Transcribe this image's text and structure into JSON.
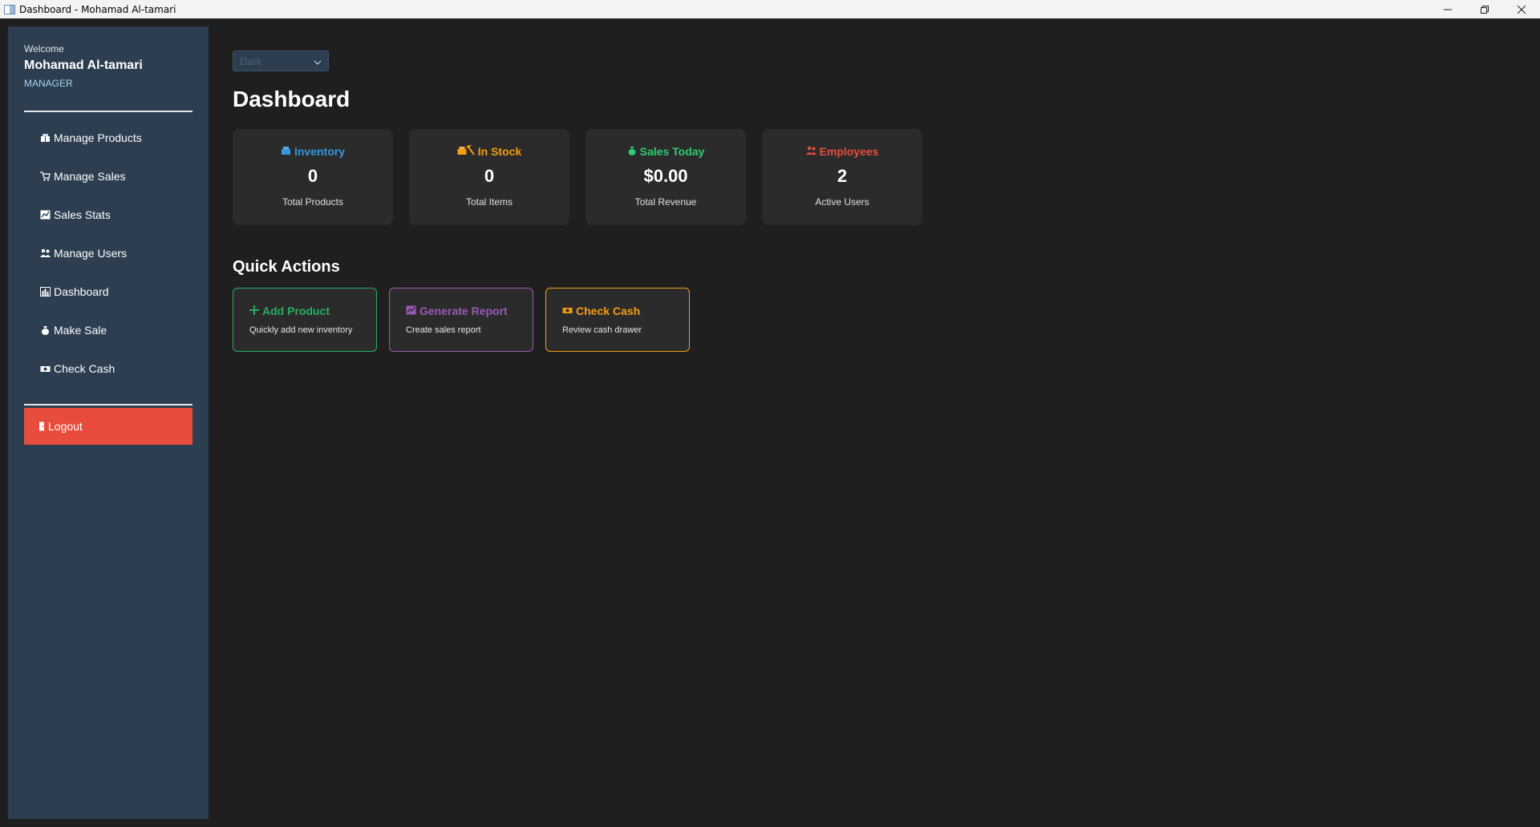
{
  "window": {
    "title": "Dashboard - Mohamad Al-tamari"
  },
  "sidebar": {
    "welcome": "Welcome",
    "username": "Mohamad Al-tamari",
    "role": "MANAGER",
    "items": [
      {
        "label": "Manage Products",
        "icon": "package-icon"
      },
      {
        "label": "Manage Sales",
        "icon": "cart-icon"
      },
      {
        "label": "Sales Stats",
        "icon": "chart-icon"
      },
      {
        "label": "Manage Users",
        "icon": "users-icon"
      },
      {
        "label": "Dashboard",
        "icon": "bar-chart-icon"
      },
      {
        "label": "Make Sale",
        "icon": "money-bag-icon"
      },
      {
        "label": "Check Cash",
        "icon": "banknote-icon"
      }
    ],
    "logout": "Logout"
  },
  "theme_selector": {
    "value": "Dark"
  },
  "main": {
    "title": "Dashboard",
    "cards": [
      {
        "title": "Inventory",
        "value": "0",
        "sub": "Total Products",
        "color": "#3498db",
        "icon": "package-icon"
      },
      {
        "title": "In Stock",
        "value": "0",
        "sub": "Total Items",
        "color": "#f39c12",
        "icon": "package-pick-icon"
      },
      {
        "title": "Sales Today",
        "value": "$0.00",
        "sub": "Total Revenue",
        "color": "#2ecc71",
        "icon": "money-bag-icon"
      },
      {
        "title": "Employees",
        "value": "2",
        "sub": "Active Users",
        "color": "#e74c3c",
        "icon": "users-icon"
      }
    ],
    "quick_actions_title": "Quick Actions",
    "quick_actions": [
      {
        "title": "Add Product",
        "sub": "Quickly add new inventory",
        "color": "#27ae60",
        "icon": "plus-icon"
      },
      {
        "title": "Generate Report",
        "sub": "Create sales report",
        "color": "#9b59b6",
        "icon": "chart-icon"
      },
      {
        "title": "Check Cash",
        "sub": "Review cash drawer",
        "color": "#f39c12",
        "icon": "banknote-icon"
      }
    ]
  },
  "colors": {
    "background": "#1f1f1f",
    "sidebar": "#2c3e50",
    "logout": "#e74c3c",
    "card": "#2b2b2b"
  }
}
